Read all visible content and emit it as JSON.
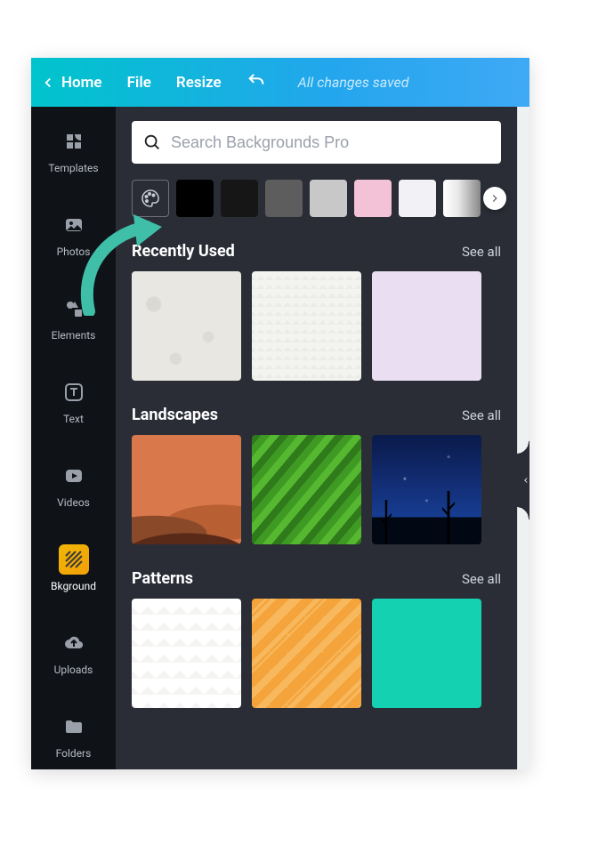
{
  "topbar": {
    "home": "Home",
    "file": "File",
    "resize": "Resize",
    "saved_status": "All changes saved"
  },
  "sidenav": {
    "items": [
      {
        "id": "templates",
        "label": "Templates"
      },
      {
        "id": "photos",
        "label": "Photos"
      },
      {
        "id": "elements",
        "label": "Elements"
      },
      {
        "id": "text",
        "label": "Text"
      },
      {
        "id": "videos",
        "label": "Videos"
      },
      {
        "id": "bkground",
        "label": "Bkground"
      },
      {
        "id": "uploads",
        "label": "Uploads"
      },
      {
        "id": "folders",
        "label": "Folders"
      }
    ],
    "active": "bkground"
  },
  "search": {
    "placeholder": "Search Backgrounds Pro"
  },
  "swatches": [
    {
      "id": "palette",
      "type": "palette"
    },
    {
      "id": "black",
      "color": "#000000"
    },
    {
      "id": "nearblack",
      "color": "#161616"
    },
    {
      "id": "gray",
      "color": "#5d5d5d"
    },
    {
      "id": "silver",
      "color": "#c8c8c8"
    },
    {
      "id": "pink",
      "color": "#f4c2d7"
    },
    {
      "id": "offwhite",
      "color": "#f2f1f6"
    },
    {
      "id": "gradient",
      "type": "gradient"
    }
  ],
  "sections": {
    "recent": {
      "title": "Recently Used",
      "see_all": "See all"
    },
    "landscapes": {
      "title": "Landscapes",
      "see_all": "See all"
    },
    "patterns": {
      "title": "Patterns",
      "see_all": "See all"
    }
  }
}
